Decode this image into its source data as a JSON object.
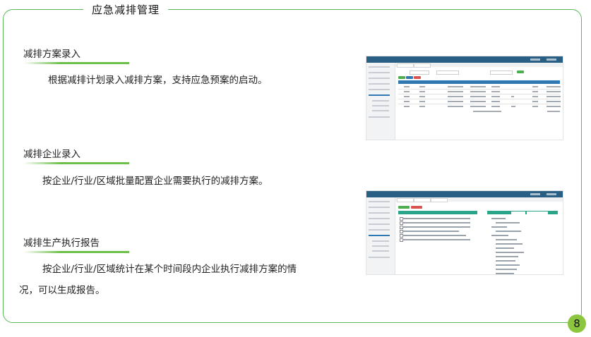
{
  "page": {
    "title": "应急减排管理",
    "page_number": "8"
  },
  "sections": [
    {
      "heading": "减排方案录入",
      "text": "根据减排计划录入减排方案，支持应急预案的启动。"
    },
    {
      "heading": "减排企业录入",
      "text": "按企业/行业/区域批量配置企业需要执行的减排方案。"
    },
    {
      "heading": "减排生产执行报告",
      "text_line1": "按企业/行业/区域统计在某个时间段内企业执行减排方案的情",
      "text_line2": "况，可以生成报告。"
    }
  ],
  "colors": {
    "frame_border": "#5cb85c",
    "accent_green": "#8cc63f",
    "app_header": "#2a5f85",
    "table_header": "#2f78b3",
    "panel_teal": "#2aa58a"
  }
}
